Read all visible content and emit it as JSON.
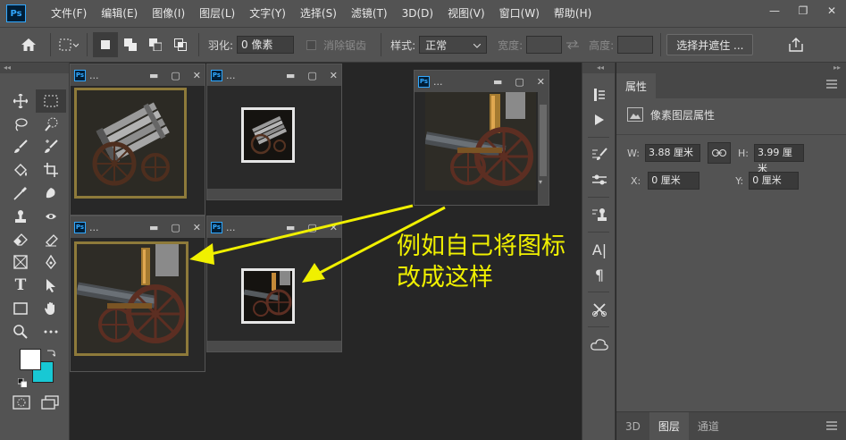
{
  "app": {
    "logo": "Ps",
    "menu": [
      "文件(F)",
      "编辑(E)",
      "图像(I)",
      "图层(L)",
      "文字(Y)",
      "选择(S)",
      "滤镜(T)",
      "3D(D)",
      "视图(V)",
      "窗口(W)",
      "帮助(H)"
    ],
    "window_controls": {
      "minimize": "—",
      "restore": "❐",
      "close": "✕"
    }
  },
  "options": {
    "feather_label": "羽化:",
    "feather_value": "0 像素",
    "antialias_label": "消除锯齿",
    "style_label": "样式:",
    "style_value": "正常",
    "width_label": "宽度:",
    "height_label": "高度:",
    "select_mask_button": "选择并遮住 ..."
  },
  "documents": [
    {
      "name": "..."
    },
    {
      "name": "..."
    },
    {
      "name": "..."
    },
    {
      "name": "..."
    },
    {
      "name": "..."
    }
  ],
  "annotation": {
    "line1": "例如自己将图标",
    "line2": "改成这样"
  },
  "properties": {
    "tab": "属性",
    "type_label": "像素图层属性",
    "w_label": "W:",
    "w_value": "3.88 厘米",
    "h_label": "H:",
    "h_value": "3.99 厘米",
    "x_label": "X:",
    "x_value": "0 厘米",
    "y_label": "Y:",
    "y_value": "0 厘米"
  },
  "bottom_tabs": [
    "3D",
    "图层",
    "通道"
  ],
  "colors": {
    "foreground": "#ffffff",
    "background": "#18c8d4",
    "annotation": "#f0f000"
  }
}
